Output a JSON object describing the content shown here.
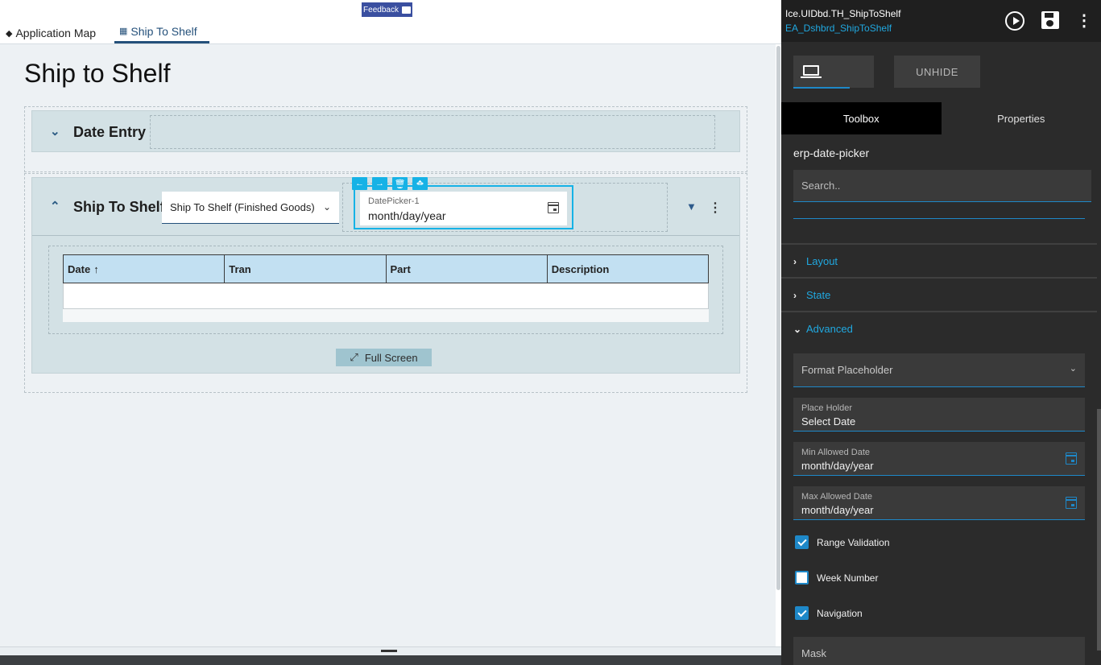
{
  "top_nav": {
    "app_map_label": "Application Map",
    "active_tab_label": "Ship To Shelf",
    "feedback_label": "Feedback"
  },
  "page": {
    "title": "Ship to Shelf"
  },
  "date_entry_panel": {
    "title": "Date Entry"
  },
  "ship_panel": {
    "title": "Ship To Shelf",
    "select_value": "Ship To Shelf (Finished Goods)",
    "datepicker": {
      "label": "DatePicker-1",
      "value": "month/day/year"
    },
    "grid": {
      "columns": [
        "Date",
        "Tran",
        "Part",
        "Description"
      ],
      "sort_indicator": "↑"
    },
    "fullscreen_label": "Full Screen"
  },
  "designer": {
    "title": "Ice.UIDbd.TH_ShipToShelf",
    "subtitle": "EA_Dshbrd_ShipToShelf",
    "unhide_label": "UNHIDE",
    "tabs": [
      "Toolbox",
      "Properties"
    ],
    "component_name": "erp-date-picker",
    "search_placeholder": "Search..",
    "sections": {
      "layout": "Layout",
      "state": "State",
      "advanced": "Advanced"
    },
    "fields": {
      "format_placeholder": "Format Placeholder",
      "place_holder_label": "Place Holder",
      "place_holder_value": "Select Date",
      "min_date_label": "Min Allowed Date",
      "min_date_value": "month/day/year",
      "max_date_label": "Max Allowed Date",
      "max_date_value": "month/day/year",
      "mask_label": "Mask"
    },
    "checkboxes": {
      "range_validation": {
        "label": "Range Validation",
        "checked": true
      },
      "week_number": {
        "label": "Week Number",
        "checked": false
      },
      "navigation": {
        "label": "Navigation",
        "checked": true
      }
    }
  },
  "colors": {
    "accent_blue": "#1e88c8",
    "selection_cyan": "#16b2e6",
    "nav_active": "#24507a",
    "panel_bg": "#d3e1e5",
    "grid_header": "#c2e0f2",
    "designer_bg": "#2b2b2b"
  },
  "icons": {
    "app_map": "layers-icon",
    "ship_tab": "dashboard-icon",
    "feedback": "chat-bubble-icon",
    "grid_filter": "filter-icon",
    "datepicker": "calendar-icon",
    "designer_run": "play-icon",
    "designer_save": "save-icon"
  }
}
